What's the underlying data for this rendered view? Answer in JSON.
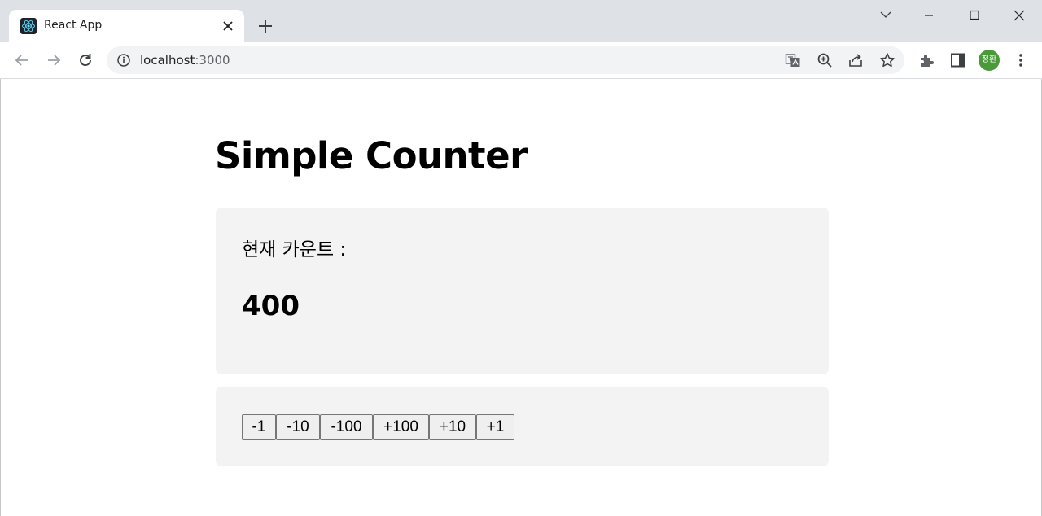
{
  "browser": {
    "tab": {
      "title": "React App"
    },
    "address": {
      "host": "localhost",
      "port": ":3000"
    },
    "profile": {
      "initials": "정환"
    }
  },
  "app": {
    "title": "Simple Counter",
    "count_label": "현재 카운트 :",
    "count_value": "400",
    "buttons": [
      {
        "label": "-1"
      },
      {
        "label": "-10"
      },
      {
        "label": "-100"
      },
      {
        "label": "+100"
      },
      {
        "label": "+10"
      },
      {
        "label": "+1"
      }
    ]
  },
  "colors": {
    "card_background": "#f3f3f4",
    "tabstrip_background": "#dee1e6",
    "avatar_background": "#4a9a3a"
  }
}
